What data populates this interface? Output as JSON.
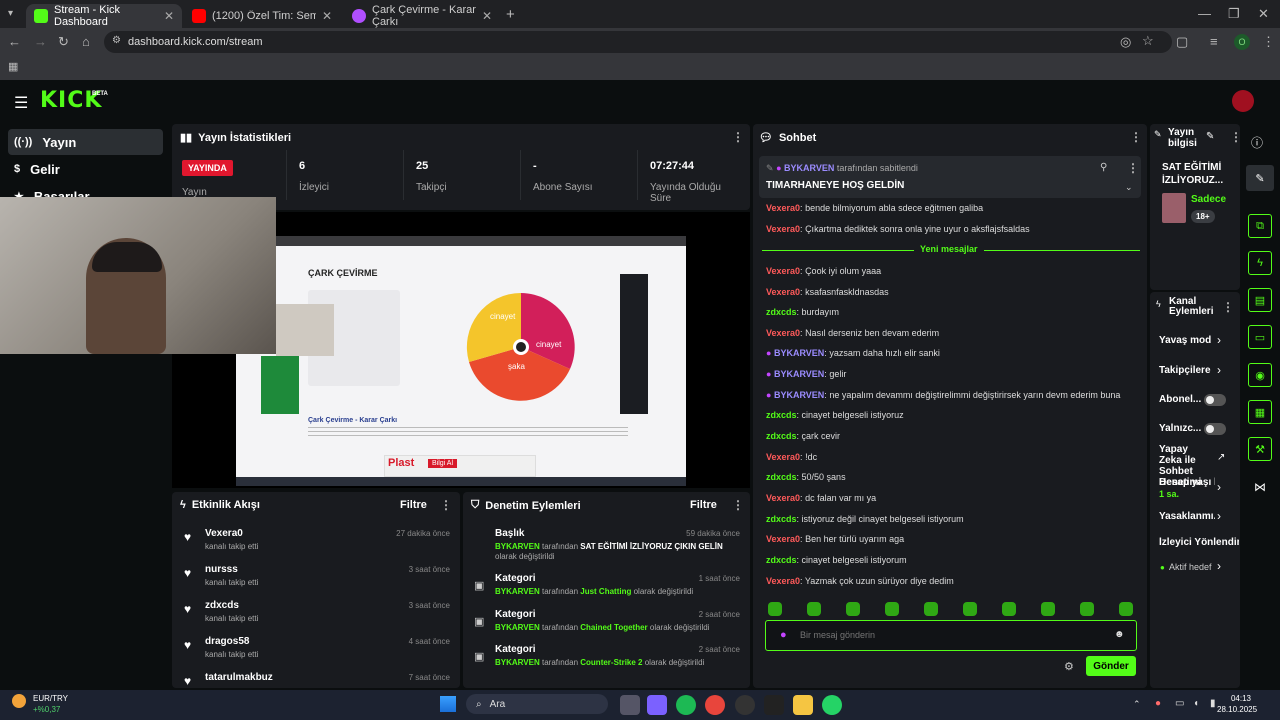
{
  "browser": {
    "tabs": [
      {
        "label": "Stream - Kick Dashboard",
        "color": "#53fc18"
      },
      {
        "label": "(1200) Özel Tim: Semender | 1...",
        "color": "#ff0000"
      },
      {
        "label": "Çark Çevirme - Karar Çarkı",
        "color": "#b04fff"
      }
    ],
    "url": "dashboard.kick.com/stream",
    "profile": "O"
  },
  "kick": {
    "logo": "KICK",
    "beta": "BETA"
  },
  "nav": {
    "items": [
      "Yayın",
      "Gelir",
      "Başarılar"
    ]
  },
  "stats": {
    "title": "Yayın İstatistikleri",
    "live_badge": "YAYINDA",
    "live_label": "Yayın",
    "items": [
      {
        "value": "6",
        "label": "İzleyici"
      },
      {
        "value": "25",
        "label": "Takipçi"
      },
      {
        "value": "-",
        "label": "Abone Sayısı"
      },
      {
        "value": "07:27:44",
        "label": "Yayında Olduğu Süre"
      }
    ]
  },
  "preview": {
    "wheel_title": "ÇARK ÇEVİRME",
    "page_heading": "Çark Çevirme - Karar Çarkı",
    "slices": [
      "cinayet",
      "şaka",
      "cinayet"
    ],
    "ad_text": "Plast",
    "ad_btn": "Bilgi Al"
  },
  "feed": {
    "title": "Etkinlik Akışı",
    "filter": "Filtre",
    "items": [
      {
        "name": "Vexera0",
        "sub": "kanalı takip etti",
        "time": "27 dakika önce"
      },
      {
        "name": "nursss",
        "sub": "kanalı takip etti",
        "time": "3 saat önce"
      },
      {
        "name": "zdxcds",
        "sub": "kanalı takip etti",
        "time": "3 saat önce"
      },
      {
        "name": "dragos58",
        "sub": "kanalı takip etti",
        "time": "4 saat önce"
      },
      {
        "name": "tatarulmakbuz",
        "sub": "",
        "time": "7 saat önce"
      }
    ]
  },
  "mod": {
    "title": "Denetim Eylemleri",
    "filter": "Filtre",
    "items": [
      {
        "kind": "Başlık",
        "time": "59 dakika önce",
        "user": "BYKARVEN",
        "mid": "tarafından",
        "value": "SAT EĞİTİMİ İZLİYORUZ ÇIKIN GELİN",
        "tail": "olarak değiştirildi"
      },
      {
        "kind": "Kategori",
        "time": "1 saat önce",
        "user": "BYKARVEN",
        "mid": "tarafından",
        "value": "Just Chatting",
        "tail": "olarak değiştirildi"
      },
      {
        "kind": "Kategori",
        "time": "2 saat önce",
        "user": "BYKARVEN",
        "mid": "tarafından",
        "value": "Chained Together",
        "tail": "olarak değiştirildi"
      },
      {
        "kind": "Kategori",
        "time": "2 saat önce",
        "user": "BYKARVEN",
        "mid": "tarafından",
        "value": "Counter-Strike 2",
        "tail": "olarak değiştirildi"
      }
    ]
  },
  "chat": {
    "title": "Sohbet",
    "pinned_by": "BYKARVEN",
    "pinned_mid": "tarafından sabitlendi",
    "pinned_msg": "TIMARHANEYE HOŞ GELDİN",
    "new_messages": "Yeni mesajlar",
    "messages": [
      {
        "user": "Vexera0",
        "text": "bende bilmiyorum abla sdece eğitmen galiba",
        "kind": "p"
      },
      {
        "user": "Vexera0",
        "text": "Çıkartma dediktek sonra onla yine uyur o aksflajsfsaldas",
        "kind": "p"
      },
      {
        "user": "Vexera0",
        "text": "Çook iyi olum yaaa",
        "kind": "p"
      },
      {
        "user": "Vexera0",
        "text": "ksafasnfaskldnasdas",
        "kind": "p"
      },
      {
        "user": "zdxcds",
        "text": "burdayım",
        "kind": "g"
      },
      {
        "user": "Vexera0",
        "text": "Nasıl derseniz ben devam ederim",
        "kind": "p"
      },
      {
        "user": "BYKARVEN",
        "text": "yazsam daha hızlı elir sanki",
        "kind": "b"
      },
      {
        "user": "BYKARVEN",
        "text": "gelir",
        "kind": "b"
      },
      {
        "user": "BYKARVEN",
        "text": "ne yapalım devammı değiştirelimmi değiştirirsek yarın devm ederim buna",
        "kind": "b"
      },
      {
        "user": "zdxcds",
        "text": "cinayet belgeseli istiyoruz",
        "kind": "g"
      },
      {
        "user": "zdxcds",
        "text": "çark cevir",
        "kind": "g"
      },
      {
        "user": "Vexera0",
        "text": "!dc",
        "kind": "p"
      },
      {
        "user": "zdxcds",
        "text": "50/50 şans",
        "kind": "g"
      },
      {
        "user": "Vexera0",
        "text": "dc falan var mı ya",
        "kind": "p"
      },
      {
        "user": "zdxcds",
        "text": "istiyoruz değil cinayet belgeseli istiyorum",
        "kind": "g"
      },
      {
        "user": "Vexera0",
        "text": "Ben her türlü uyarım aga",
        "kind": "p"
      },
      {
        "user": "zdxcds",
        "text": "cinayet belgeseli istiyorum",
        "kind": "g"
      },
      {
        "user": "Vexera0",
        "text": "Yazmak çok uzun sürüyor diye dedim",
        "kind": "p"
      }
    ],
    "placeholder": "Bir mesaj gönderin",
    "send": "Gönder"
  },
  "info": {
    "title": "Yayın bilgisi",
    "stream_title": "SAT EĞİTİMİ İZLİYORUZ...",
    "sub": "Sadece",
    "age": "18+"
  },
  "actions": {
    "title": "Kanal Eylemleri",
    "items": [
      "Yavaş mod",
      "Takipçilere ...",
      "Abonel...",
      "Yalnızc...",
      "Yapay Zeka ile Sohbet Denetimi",
      "Hesap yaşı l",
      "1 sa.",
      "Yasaklanmı...",
      "İzleyici Yönlendir",
      "Aktif hedef"
    ]
  },
  "taskbar": {
    "currency": "EUR/TRY",
    "change": "+%0,37",
    "search": "Ara",
    "time": "04:13",
    "date": "28.10.2025"
  }
}
